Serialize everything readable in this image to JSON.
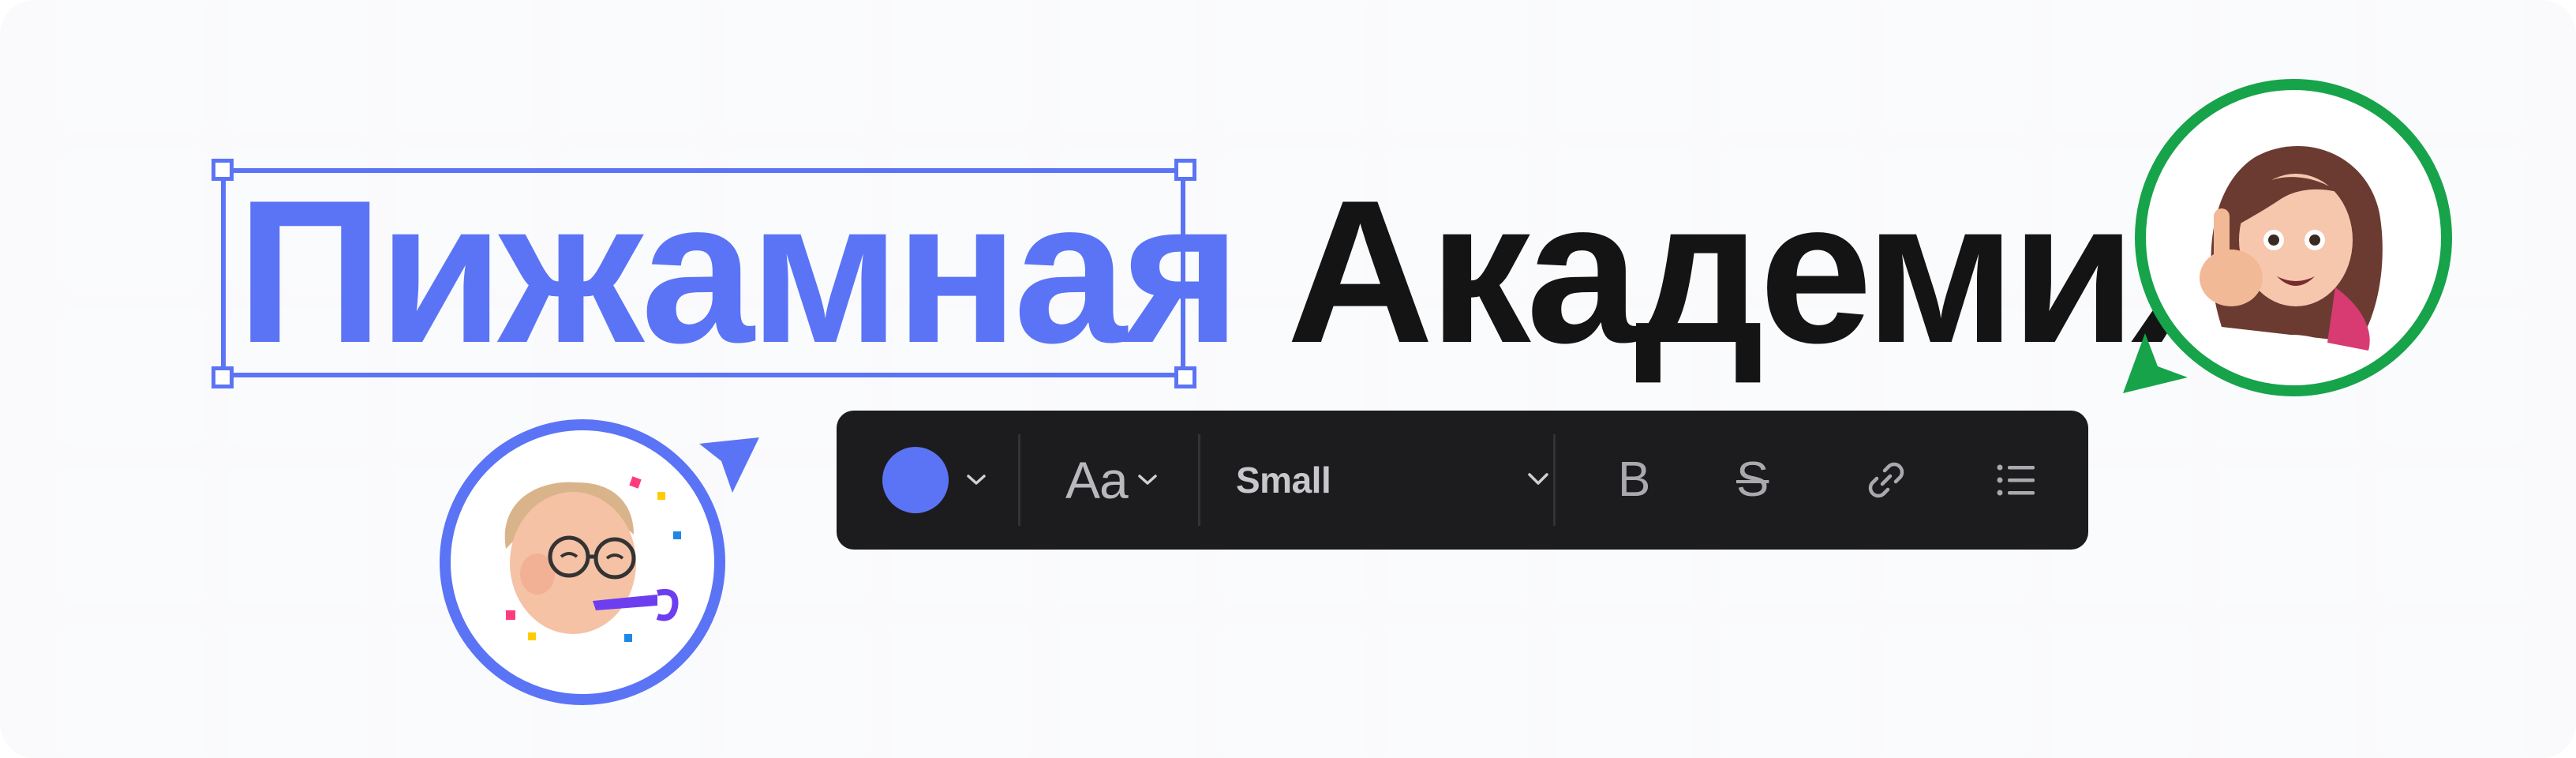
{
  "title": {
    "selected_word": "Пижамная",
    "plain_word": "Академия"
  },
  "toolbar": {
    "color_swatch": "#5b74f5",
    "color_dropdown_icon": "chevron-down-icon",
    "font_button_label": "Aa",
    "font_dropdown_icon": "chevron-down-icon",
    "size_select_value": "Small",
    "size_dropdown_icon": "chevron-down-icon",
    "bold_label": "B",
    "strikethrough_label": "S",
    "link_icon": "link-icon",
    "list_icon": "bullet-list-icon"
  },
  "avatars": [
    {
      "name": "boy-memoji-avatar",
      "ring_color": "#5b74f5",
      "cursor_color": "#5b74f5"
    },
    {
      "name": "girl-memoji-avatar",
      "ring_color": "#17a34a",
      "cursor_color": "#17a34a"
    }
  ],
  "colors": {
    "accent_blue": "#5b74f5",
    "accent_green": "#17a34a",
    "toolbar_bg": "#1c1c1e",
    "text_dark": "#141414"
  }
}
